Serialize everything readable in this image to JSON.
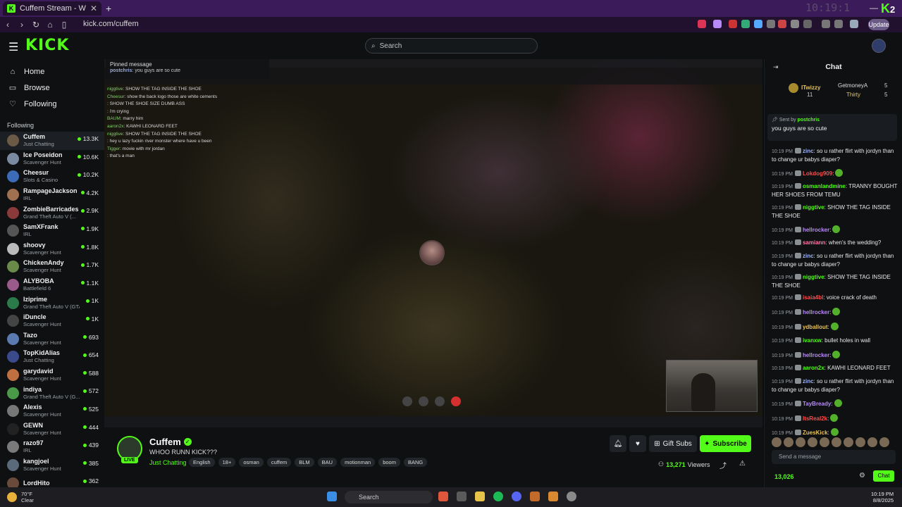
{
  "browser": {
    "tab_title": "Cuffem Stream - Watch Live",
    "new_tab": "+",
    "url": "kick.com/cuffem",
    "clock_overlay": "10:19:1",
    "update_label": "Update",
    "corner_logo": "2"
  },
  "header": {
    "logo": "KICK",
    "search_placeholder": "Search"
  },
  "sidebar": {
    "nav": [
      {
        "label": "Home",
        "icon": "home-icon"
      },
      {
        "label": "Browse",
        "icon": "browse-icon"
      },
      {
        "label": "Following",
        "icon": "heart-icon"
      }
    ],
    "following_title": "Following",
    "channels": [
      {
        "name": "Cuffem",
        "category": "Just Chatting",
        "viewers": "13.3K"
      },
      {
        "name": "Ice Poseidon",
        "category": "Scavenger Hunt",
        "viewers": "10.6K"
      },
      {
        "name": "Cheesur",
        "category": "Slots & Casino",
        "viewers": "10.2K"
      },
      {
        "name": "RampageJackson",
        "category": "IRL",
        "viewers": "4.2K"
      },
      {
        "name": "ZombieBarricades",
        "category": "Grand Theft Auto V (...",
        "viewers": "2.9K"
      },
      {
        "name": "SamXFrank",
        "category": "IRL",
        "viewers": "1.9K"
      },
      {
        "name": "shoovy",
        "category": "Scavenger Hunt",
        "viewers": "1.8K"
      },
      {
        "name": "ChickenAndy",
        "category": "Scavenger Hunt",
        "viewers": "1.7K"
      },
      {
        "name": "ALYBOBA",
        "category": "Battlefield 6",
        "viewers": "1.1K"
      },
      {
        "name": "Iziprime",
        "category": "Grand Theft Auto V (GTA)",
        "viewers": "1K"
      },
      {
        "name": "iDuncle",
        "category": "Scavenger Hunt",
        "viewers": "1K"
      },
      {
        "name": "Tazo",
        "category": "Scavenger Hunt",
        "viewers": "693"
      },
      {
        "name": "TopKidAlias",
        "category": "Just Chatting",
        "viewers": "654"
      },
      {
        "name": "garydavid",
        "category": "Scavenger Hunt",
        "viewers": "588"
      },
      {
        "name": "indiya",
        "category": "Grand Theft Auto V (G...",
        "viewers": "572"
      },
      {
        "name": "Alexis",
        "category": "Scavenger Hunt",
        "viewers": "525"
      },
      {
        "name": "GEWN",
        "category": "Scavenger Hunt",
        "viewers": "444"
      },
      {
        "name": "razo97",
        "category": "IRL",
        "viewers": "439"
      },
      {
        "name": "kangjoel",
        "category": "Scavenger Hunt",
        "viewers": "385"
      },
      {
        "name": "LordHito",
        "category": "",
        "viewers": "362"
      }
    ]
  },
  "video": {
    "pinned_header": "Pinned message",
    "pinned_user": "postchris",
    "pinned_text": ": you guys are so cute",
    "overlay_lines": [
      {
        "user": "niggtive",
        "text": ": SHOW THE TAG INSIDE THE SHOE",
        "cls": "u"
      },
      {
        "user": "Cheesur",
        "text": ": show the back logo those are white cements",
        "cls": "u"
      },
      {
        "user": "",
        "text": ": SHOW THE SHOE SIZE DUMB ASS",
        "cls": "r"
      },
      {
        "user": "",
        "text": ": i'm crying",
        "cls": "p"
      },
      {
        "user": "BAUM",
        "text": ": marry him",
        "cls": "u"
      },
      {
        "user": "aaron2x",
        "text": ": KAWHI LEONARD FEET",
        "cls": "u"
      },
      {
        "user": "niggtive",
        "text": ": SHOW THE TAG INSIDE THE SHOE",
        "cls": "u"
      },
      {
        "user": "",
        "text": ": hey u lazy fuckin river monster where have u been",
        "cls": "r"
      },
      {
        "user": "Tigger",
        "text": ": movie with mr jordan",
        "cls": "u"
      },
      {
        "user": "",
        "text": ": that's a man",
        "cls": "p"
      }
    ]
  },
  "stream": {
    "name": "Cuffem",
    "live": "LIVE",
    "title": "WHOO RUNN KICK???",
    "category": "Just Chatting",
    "tags": [
      "English",
      "18+",
      "osman",
      "cuffem",
      "BLM",
      "BAU",
      "motionman",
      "boom",
      "BANG"
    ],
    "gift_label": "Gift Subs",
    "subscribe_label": "Subscribe",
    "viewers": "13,271",
    "viewers_label": "Viewers"
  },
  "chat": {
    "title": "Chat",
    "top_gifters": [
      {
        "name": "ITwizzy",
        "count": "11"
      },
      {
        "name": "GetmoneyA",
        "count": "5"
      },
      {
        "name": "Thirty",
        "count": "5"
      }
    ],
    "pinned_sent_by": "Sent by",
    "pinned_user": "postchris",
    "pinned_text": "you guys are so cute",
    "messages": [
      {
        "time": "10:19 PM",
        "user": "zinc",
        "color": "#9fb6ff",
        "text": ": so u rather flirt with jordyn than to change ur babys diaper?"
      },
      {
        "time": "10:19 PM",
        "user": "Lokdog909",
        "color": "#ff4d4d",
        "text": ":",
        "emote": true
      },
      {
        "time": "10:19 PM",
        "user": "osmanlandmine",
        "color": "#53fc18",
        "text": ": TRANNY BOUGHT HER SHOES FROM TEMU"
      },
      {
        "time": "10:19 PM",
        "user": "niggtive",
        "color": "#53fc18",
        "text": ": SHOW THE TAG INSIDE THE SHOE"
      },
      {
        "time": "10:19 PM",
        "user": "hellrocker",
        "color": "#b88bf5",
        "text": ":",
        "emote": true
      },
      {
        "time": "10:19 PM",
        "user": "samiann",
        "color": "#ff7aa8",
        "text": ": when's the wedding?"
      },
      {
        "time": "10:19 PM",
        "user": "zinc",
        "color": "#9fb6ff",
        "text": ": so u rather flirt with jordyn than to change ur babys diaper?"
      },
      {
        "time": "10:19 PM",
        "user": "niggtive",
        "color": "#53fc18",
        "text": ": SHOW THE TAG INSIDE THE SHOE"
      },
      {
        "time": "10:19 PM",
        "user": "isaia4bl",
        "color": "#ff4d4d",
        "text": ": voice crack of death"
      },
      {
        "time": "10:19 PM",
        "user": "hellrocker",
        "color": "#b88bf5",
        "text": ":",
        "emote": true
      },
      {
        "time": "10:19 PM",
        "user": "ydballout",
        "color": "#e7c25e",
        "text": ":",
        "emote": true
      },
      {
        "time": "10:19 PM",
        "user": "ivanxw",
        "color": "#53fc18",
        "text": ": bullet holes in wall"
      },
      {
        "time": "10:19 PM",
        "user": "hellrocker",
        "color": "#b88bf5",
        "text": ":",
        "emote": true
      },
      {
        "time": "10:19 PM",
        "user": "aaron2x",
        "color": "#53fc18",
        "text": ": KAWHI LEONARD FEET"
      },
      {
        "time": "10:19 PM",
        "user": "zinc",
        "color": "#9fb6ff",
        "text": ": so u rather flirt with jordyn than to change ur babys diaper?"
      },
      {
        "time": "10:19 PM",
        "user": "TayBready",
        "color": "#b88bf5",
        "text": ":",
        "emote": true
      },
      {
        "time": "10:19 PM",
        "user": "ItsReal2k",
        "color": "#ff4d4d",
        "text": ":",
        "emote": true
      },
      {
        "time": "10:19 PM",
        "user": "ZuesKick",
        "color": "#e7c25e",
        "text": ":",
        "emote": true
      }
    ],
    "input_placeholder": "Send a message",
    "points": "13,026",
    "send_label": "Chat"
  },
  "taskbar": {
    "weather_temp": "70°F",
    "weather_desc": "Clear",
    "search": "Search",
    "time": "10:19 PM",
    "date": "8/8/2025"
  }
}
